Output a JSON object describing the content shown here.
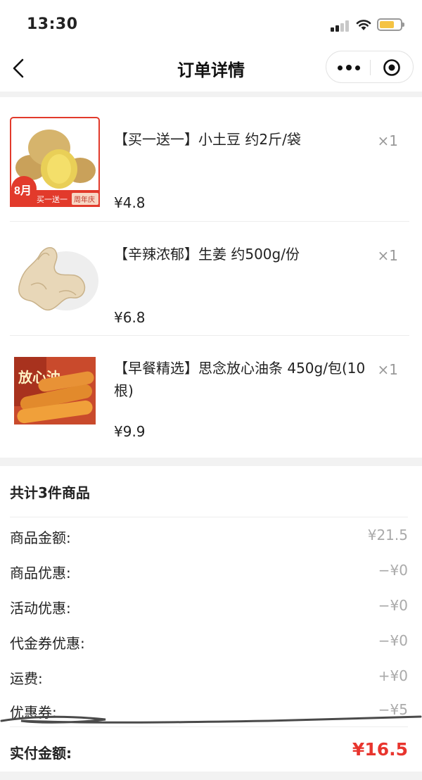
{
  "status_bar": {
    "time": "13:30",
    "icons": [
      "signal-icon",
      "wifi-icon",
      "battery-icon"
    ]
  },
  "nav": {
    "title": "订单详情",
    "back_icon": "chevron-left-icon",
    "capsule_icons": [
      "more-icon",
      "target-icon"
    ]
  },
  "products": [
    {
      "title": "【买一送一】小土豆 约2斤/袋",
      "qty": "×1",
      "price": "¥4.8",
      "image": {
        "badge_month": "8月",
        "badge_text": "买一送一",
        "badge_tag": "周年庆"
      }
    },
    {
      "title": "【辛辣浓郁】生姜 约500g/份",
      "qty": "×1",
      "price": "¥6.8",
      "image": {}
    },
    {
      "title": "【早餐精选】思念放心油条 450g/包(10根)",
      "qty": "×1",
      "price": "¥9.9",
      "image": {
        "pack_text": "放心油"
      }
    }
  ],
  "summary": {
    "total_items": "共计3件商品",
    "rows": [
      {
        "label": "商品金额:",
        "value": "¥21.5"
      },
      {
        "label": "商品优惠:",
        "value": "−¥0"
      },
      {
        "label": "活动优惠:",
        "value": "−¥0"
      },
      {
        "label": "代金券优惠:",
        "value": "−¥0"
      },
      {
        "label": "运费:",
        "value": "+¥0"
      },
      {
        "label": "优惠券:",
        "value": "−¥5"
      }
    ],
    "pay_label": "实付金额:",
    "pay_value": "¥16.5"
  },
  "colors": {
    "accent_red": "#e8352e",
    "muted_gray": "#aaaaaa",
    "badge_red": "#e23a2b"
  }
}
